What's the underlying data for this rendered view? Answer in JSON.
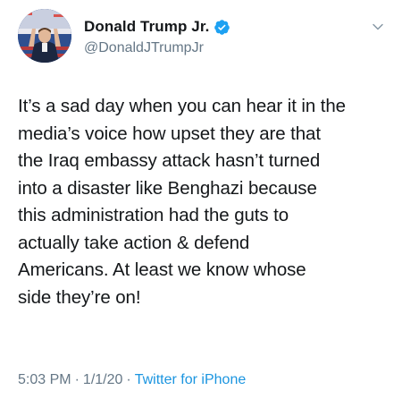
{
  "author": {
    "display_name": "Donald Trump Jr.",
    "handle": "@DonaldJTrumpJr",
    "verified": true,
    "avatar_icon": "profile-photo"
  },
  "menu_icon": "chevron-down-icon",
  "tweet": {
    "text": "It’s a sad day when you can hear it in the\nmedia’s voice how upset they are that\nthe Iraq embassy attack hasn’t turned\ninto a disaster like Benghazi because\nthis administration had the guts to\nactually take action & defend\nAmericans. At least we know whose\nside they’re on!",
    "time": "5:03 PM",
    "separator_1": "·",
    "date": "1/1/20",
    "separator_2": "·",
    "source": "Twitter for iPhone"
  },
  "colors": {
    "verified_badge": "#1da1f2",
    "meta_text": "#657786",
    "source_link": "#1b95e0"
  }
}
